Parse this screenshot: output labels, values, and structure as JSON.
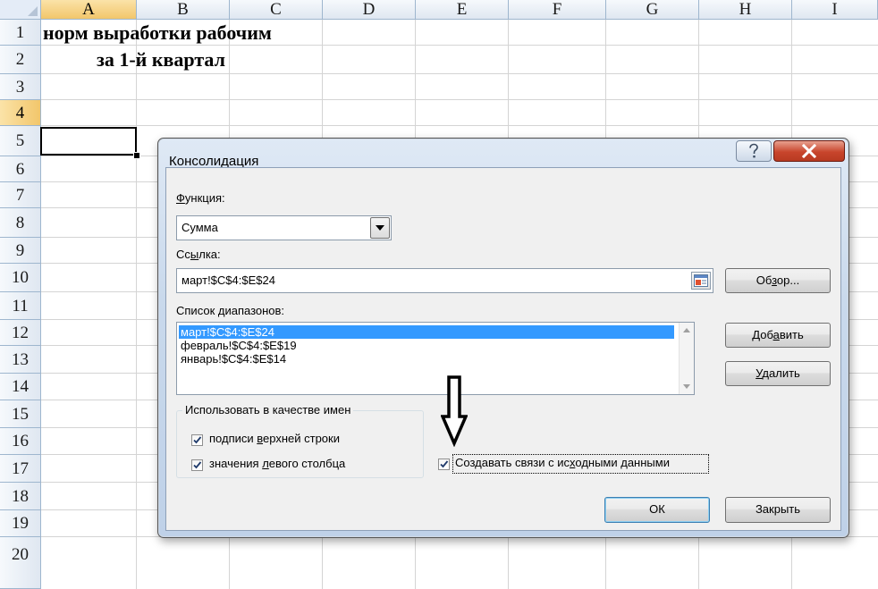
{
  "sheet": {
    "columns": [
      "A",
      "B",
      "C",
      "D",
      "E",
      "F",
      "G",
      "H",
      "I"
    ],
    "selected_column": "A",
    "rows": [
      "1",
      "2",
      "3",
      "4",
      "5",
      "6",
      "7",
      "8",
      "9",
      "10",
      "11",
      "12",
      "13",
      "14",
      "15",
      "16",
      "17",
      "18",
      "19",
      "20"
    ],
    "selected_row": "4",
    "cells": {
      "a1": "норм выработки рабочим",
      "a2": "за  1-й квартал"
    }
  },
  "dialog": {
    "title": "Консолидация",
    "function_label_pre": "",
    "function_label_u": "Ф",
    "function_label_post": "ункция:",
    "function_value": "Сумма",
    "reference_label_pre": "Сс",
    "reference_label_u": "ы",
    "reference_label_post": "лка:",
    "reference_value": "март!$C$4:$E$24",
    "browse_pre": "Об",
    "browse_u": "з",
    "browse_post": "ор...",
    "ranges_label": "Список диапазонов:",
    "ranges": [
      "март!$C$4:$E$24",
      "февраль!$C$4:$E$19",
      "январь!$C$4:$E$14"
    ],
    "add_pre": "Доб",
    "add_u": "а",
    "add_post": "вить",
    "delete_pre": "",
    "delete_u": "У",
    "delete_post": "далить",
    "use_labels_group": "Использовать в качестве имен",
    "top_row_pre": "подписи ",
    "top_row_u": "в",
    "top_row_post": "ерхней строки",
    "left_col_pre": "значения ",
    "left_col_u": "л",
    "left_col_post": "евого столбца",
    "links_pre": "Создавать связи с ис",
    "links_u": "х",
    "links_post": "одными данными",
    "ok": "ОК",
    "close": "Закрыть",
    "help_icon": "question-mark-icon",
    "close_icon": "close-x-icon",
    "accent_color": "#3399ff"
  }
}
